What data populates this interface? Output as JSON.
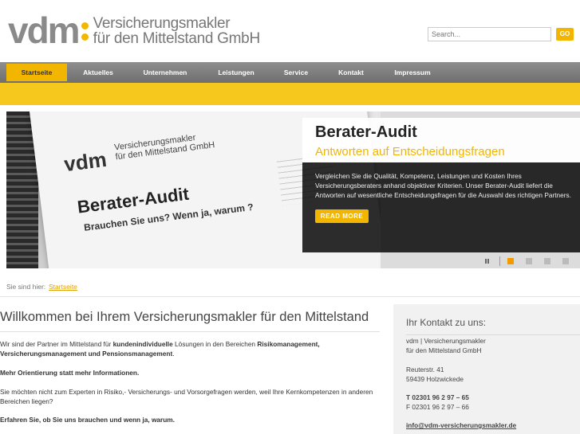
{
  "header": {
    "logo_mark": "vdm",
    "logo_line1": "Versicherungsmakler",
    "logo_line2": "für den Mittelstand GmbH",
    "search_placeholder": "Search...",
    "go_label": "GO"
  },
  "nav": {
    "items": [
      {
        "label": "Startseite",
        "active": true
      },
      {
        "label": "Aktuelles"
      },
      {
        "label": "Unternehmen"
      },
      {
        "label": "Leistungen"
      },
      {
        "label": "Service"
      },
      {
        "label": "Kontakt"
      },
      {
        "label": "Impressum"
      }
    ]
  },
  "slider": {
    "image": {
      "logo": "vdm",
      "logo_line1": "Versicherungsmakler",
      "logo_line2": "für den Mittelstand GmbH",
      "title": "Berater-Audit",
      "subtitle": "Brauchen Sie uns? Wenn ja, warum ?"
    },
    "title": "Berater-Audit",
    "subtitle": "Antworten auf Entscheidungsfragen",
    "description": "Vergleichen Sie die Qualität, Kompetenz, Leistungen und Kosten Ihres Versicherungsberaters anhand objektiver Kriterien. Unser Berater-Audit liefert die Antworten auf wesentliche Entscheidungsfragen für die Auswahl des richtigen Partners.",
    "read_more": "READ MORE",
    "active_dot": 1,
    "dot_count": 4
  },
  "breadcrumb": {
    "prefix": "Sie sind hier:",
    "current": "Startseite"
  },
  "main": {
    "title": "Willkommen bei Ihrem Versicherungsmakler für den Mittelstand",
    "p1_a": "Wir sind der Partner im Mittelstand für ",
    "p1_b": "kundenindividuelle",
    "p1_c": " Lösungen in den Bereichen ",
    "p1_d": "Risikomanagement, Versicherungsmanagement und Pensionsmanagement",
    "p1_e": ".",
    "p2": "Mehr Orientierung statt mehr Informationen.",
    "p3": "Sie möchten nicht zum Experten in Risiko,- Versicherungs- und Vorsorgefragen werden, weil Ihre Kernkompetenzen in anderen Bereichen liegen?",
    "p4": "Erfahren Sie, ob Sie uns brauchen und wenn ja, warum."
  },
  "sidebar": {
    "title": "Ihr Kontakt zu uns:",
    "company_line1": "vdm | Versicherungsmakler",
    "company_line2": "für den Mittelstand GmbH",
    "street": "Reuterstr. 41",
    "city": "59439 Holzwickede",
    "phone": "T 02301 96 2 97 – 65",
    "fax": "F 02301 96 2 97 – 66",
    "email": "info@vdm-versicherungsmakler.de"
  },
  "colors": {
    "accent": "#f2b600",
    "nav_bg": "#7d7d7d",
    "band": "#f6c71c"
  }
}
